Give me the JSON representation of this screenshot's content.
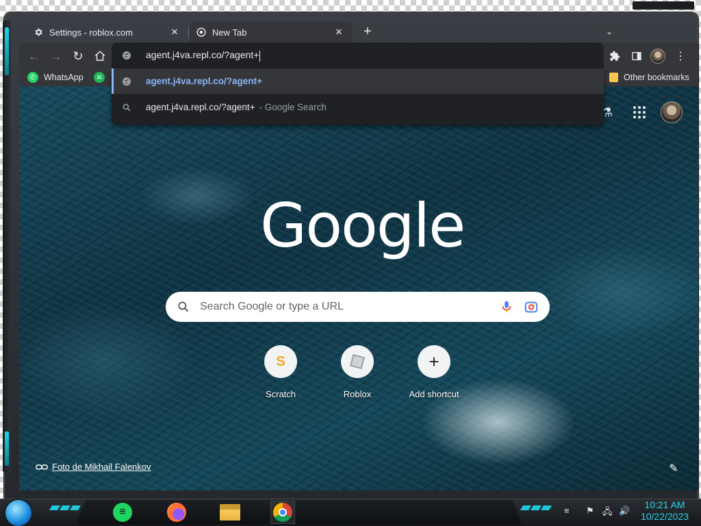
{
  "browser": {
    "tabs": [
      {
        "title": "Settings - roblox.com",
        "icon": "gear-icon",
        "active": false
      },
      {
        "title": "New Tab",
        "icon": "chrome-icon",
        "active": true
      }
    ],
    "omnibox": {
      "value": "agent.j4va.repl.co/?agent+",
      "suggestions": [
        {
          "text": "agent.j4va.repl.co/?agent+",
          "icon": "globe-icon",
          "selected": true
        },
        {
          "text": "agent.j4va.repl.co/?agent+",
          "suffix": "- Google Search",
          "icon": "search-icon",
          "selected": false
        }
      ]
    },
    "bookmarks": [
      {
        "label": "WhatsApp",
        "icon": "whatsapp-icon"
      },
      {
        "label": "",
        "icon": "spotify-icon"
      }
    ],
    "other_bookmarks": "Other bookmarks"
  },
  "ntp": {
    "logo": "Google",
    "search_placeholder": "Search Google or type a URL",
    "shortcuts": [
      {
        "label": "Scratch",
        "icon": "scratch-icon"
      },
      {
        "label": "Roblox",
        "icon": "roblox-icon"
      },
      {
        "label": "Add shortcut",
        "icon": "plus-icon"
      }
    ],
    "attribution": "Foto de Mikhail Falenkov"
  },
  "taskbar": {
    "apps": [
      "spotify-icon",
      "firefox-icon",
      "file-explorer-icon",
      "chrome-icon"
    ],
    "clock_time": "10:21 AM",
    "clock_date": "10/22/2023"
  },
  "colors": {
    "accent": "#8ab4f8",
    "toolbar": "#35363a",
    "omnibox": "#202124",
    "taskbar_accent": "#2ad6ea"
  }
}
